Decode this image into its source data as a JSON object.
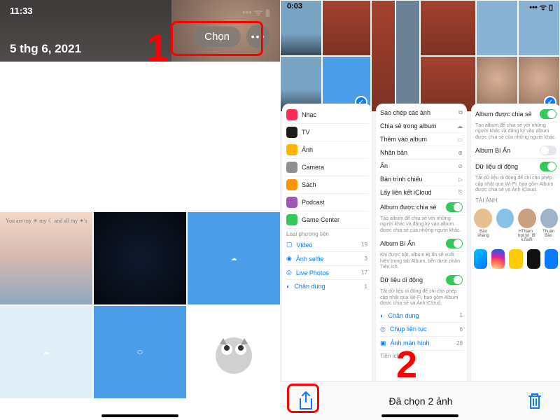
{
  "left": {
    "time": "11:33",
    "date": "5 thg 6, 2021",
    "select_button": "Chọn",
    "grid_text": "You are my ☀\nmy ☾ and all my\n✦'s"
  },
  "right": {
    "time": "0:03",
    "time2": "0:03",
    "panel1": {
      "items": [
        {
          "label": "Nhạc",
          "color": "#ff2d55"
        },
        {
          "label": "TV",
          "color": "#1c1c1e"
        },
        {
          "label": "Ảnh",
          "color": "#ffb400"
        },
        {
          "label": "Camera",
          "color": "#8e8e93"
        },
        {
          "label": "Sách",
          "color": "#ff9500"
        },
        {
          "label": "Podcast",
          "color": "#9b59b6"
        },
        {
          "label": "Game Center",
          "color": "#34c759"
        }
      ],
      "media_section": "Loại phương tiện",
      "media": [
        {
          "label": "Video",
          "count": "19"
        },
        {
          "label": "Ảnh selfie",
          "count": "3"
        },
        {
          "label": "Live Photos",
          "count": "17"
        },
        {
          "label": "Chân dung",
          "count": "1"
        }
      ]
    },
    "panel2": {
      "actions": [
        "Sao chép các ảnh",
        "Chia sẻ trong album",
        "Thêm vào album",
        "Nhân bản",
        "Ẩn",
        "Bản trình chiếu",
        "Lấy liên kết iCloud"
      ],
      "shared_title": "Album được chia sẻ",
      "shared_sub": "Tạo album để chia sẻ với những người khác và đăng ký vào album được chia sẻ của những người khác.",
      "hidden_title": "Album Bí Ẩn",
      "hidden_sub": "Khi được bật, album Bị ẩn sẽ xuất hiện trong tab Album, bên dưới phần Tiện ích.",
      "data_title": "Dữ liệu di động",
      "data_sub": "Tắt dữ liệu di động để chỉ cho phép cập nhật qua Wi-Fi, bao gồm Album được chia sẻ và Ảnh iCloud.",
      "util_section": "Tiện ích",
      "util": [
        {
          "label": "Chân dung",
          "count": "1"
        },
        {
          "label": "Chụp liên tục",
          "count": "6"
        },
        {
          "label": "Ảnh màn hình",
          "count": "28"
        }
      ]
    },
    "panel3": {
      "shared_title": "Album được chia sẻ",
      "shared_sub": "Tạo album để chia sẻ với những người khác và đăng ký vào album được chia sẻ của những người khác.",
      "hidden_title": "Album Bí Ẩn",
      "data_title": "Dữ liệu di động",
      "data_sub": "Tắt dữ liệu di động để chỉ cho phép cập nhật qua Wi-Fi, bao gồm Album được chia sẻ và Ảnh iCloud.",
      "transfer": "TẢI ẢNH",
      "apps": [
        {
          "label": "Bảo khang",
          "color": "#e8c090"
        },
        {
          "label": "",
          "color": "#88c1e8"
        },
        {
          "label": "HTNam_hpt.yn_btk.fiam",
          "color": "#c9a080"
        },
        {
          "label": "Thuận Bảo",
          "color": "#a0b4c9"
        }
      ],
      "share_apps": [
        "#0084ff",
        "#9a3fb5",
        "#ffca00",
        "#25f4ee",
        "#0a7aff"
      ]
    },
    "toolbar": {
      "selected": "Đã chọn 2 ảnh"
    }
  },
  "step_labels": {
    "one": "1",
    "two": "2"
  }
}
